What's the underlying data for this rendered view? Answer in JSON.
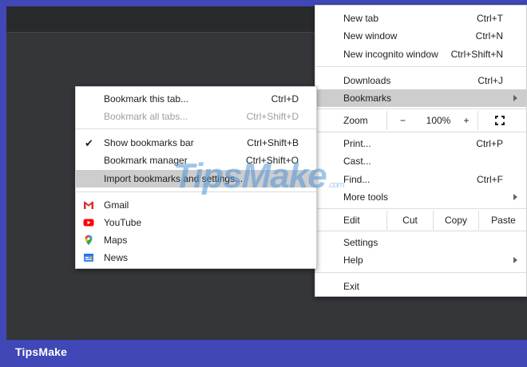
{
  "brand": {
    "footer": "TipsMake",
    "watermark": "TipsMake",
    "watermark_sub": ".com"
  },
  "main_menu": {
    "new_tab": {
      "label": "New tab",
      "shortcut": "Ctrl+T"
    },
    "new_window": {
      "label": "New window",
      "shortcut": "Ctrl+N"
    },
    "new_incognito": {
      "label": "New incognito window",
      "shortcut": "Ctrl+Shift+N"
    },
    "downloads": {
      "label": "Downloads",
      "shortcut": "Ctrl+J"
    },
    "bookmarks": {
      "label": "Bookmarks"
    },
    "zoom": {
      "label": "Zoom",
      "minus": "−",
      "value": "100%",
      "plus": "+"
    },
    "print": {
      "label": "Print...",
      "shortcut": "Ctrl+P"
    },
    "cast": {
      "label": "Cast..."
    },
    "find": {
      "label": "Find...",
      "shortcut": "Ctrl+F"
    },
    "more_tools": {
      "label": "More tools"
    },
    "edit": {
      "label": "Edit",
      "cut": "Cut",
      "copy": "Copy",
      "paste": "Paste"
    },
    "settings": {
      "label": "Settings"
    },
    "help": {
      "label": "Help"
    },
    "exit": {
      "label": "Exit"
    }
  },
  "bookmarks_menu": {
    "bookmark_tab": {
      "label": "Bookmark this tab...",
      "shortcut": "Ctrl+D"
    },
    "bookmark_all": {
      "label": "Bookmark all tabs...",
      "shortcut": "Ctrl+Shift+D"
    },
    "show_bar": {
      "label": "Show bookmarks bar",
      "shortcut": "Ctrl+Shift+B",
      "checked": true
    },
    "manager": {
      "label": "Bookmark manager",
      "shortcut": "Ctrl+Shift+O"
    },
    "import": {
      "label": "Import bookmarks and settings..."
    },
    "links": [
      {
        "label": "Gmail",
        "icon": "gmail-icon"
      },
      {
        "label": "YouTube",
        "icon": "youtube-icon"
      },
      {
        "label": "Maps",
        "icon": "maps-icon"
      },
      {
        "label": "News",
        "icon": "news-icon"
      }
    ]
  },
  "colors": {
    "background": "#3f48b6",
    "highlight": "#cdcdcd",
    "disabled_text": "#9aa0a6"
  }
}
